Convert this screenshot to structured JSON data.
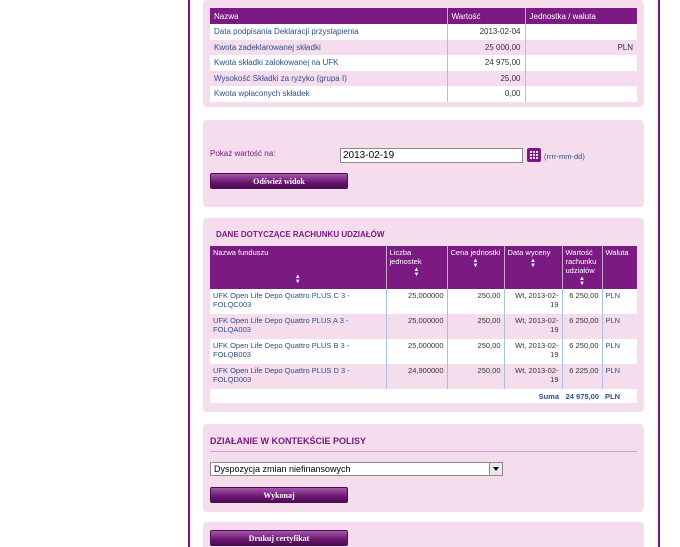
{
  "summary_table": {
    "headers": [
      "Nazwa",
      "Wartość",
      "Jednostka / waluta"
    ],
    "rows": [
      [
        "Data podpisania Deklaracji przystąpienia",
        "2013-02-04",
        ""
      ],
      [
        "Kwota zadeklarowanej składki",
        "25 000,00",
        "PLN"
      ],
      [
        "Kwota składki zalokowanej na UFK",
        "24 975,00",
        ""
      ],
      [
        "Wysokość Składki za ryzyko (grupa I)",
        "25,00",
        ""
      ],
      [
        "Kwota wpłaconych składek",
        "0,00",
        ""
      ]
    ]
  },
  "value_form": {
    "label": "Pokaż wartość na:",
    "date_value": "2013-02-19",
    "hint": "(rrrr-mm-dd)",
    "refresh_label": "Odśwież widok"
  },
  "units": {
    "title": "DANE DOTYCZĄCE RACHUNKU UDZIAŁÓW",
    "headers": [
      "Nazwa funduszu",
      "Liczba jednostek",
      "Cena jednostki",
      "Data wyceny",
      "Wartość rachunku udziałów",
      "Waluta"
    ],
    "rows": [
      [
        "UFK Open Life Depo Quattro PLUS C 3 - FOLQC003",
        "25,000000",
        "250,00",
        "Wt, 2013-02-19",
        "6 250,00",
        "PLN"
      ],
      [
        "UFK Open Life Depo Quattro PLUS A 3 - FOLQA003",
        "25,000000",
        "250,00",
        "Wt, 2013-02-19",
        "6 250,00",
        "PLN"
      ],
      [
        "UFK Open Life Depo Quattro PLUS B 3 - FOLQB003",
        "25,000000",
        "250,00",
        "Wt, 2013-02-19",
        "6 250,00",
        "PLN"
      ],
      [
        "UFK Open Life Depo Quattro PLUS D 3 - FOLQD003",
        "24,900000",
        "250,00",
        "Wt, 2013-02-19",
        "6 225,00",
        "PLN"
      ]
    ],
    "sum_label": "Suma",
    "sum_value": "24 975,00",
    "sum_currency": "PLN"
  },
  "policy_action": {
    "title": "DZIAŁANIE W KONTEKŚCIE POLISY",
    "selected": "Dyspozycja zmian niefinansowych",
    "execute_label": "Wykonaj"
  },
  "print_label": "Drukuj certyfikat",
  "colors": {
    "accent": "#7a1a82",
    "panel": "#f5dded",
    "link": "#2c4f8a"
  }
}
